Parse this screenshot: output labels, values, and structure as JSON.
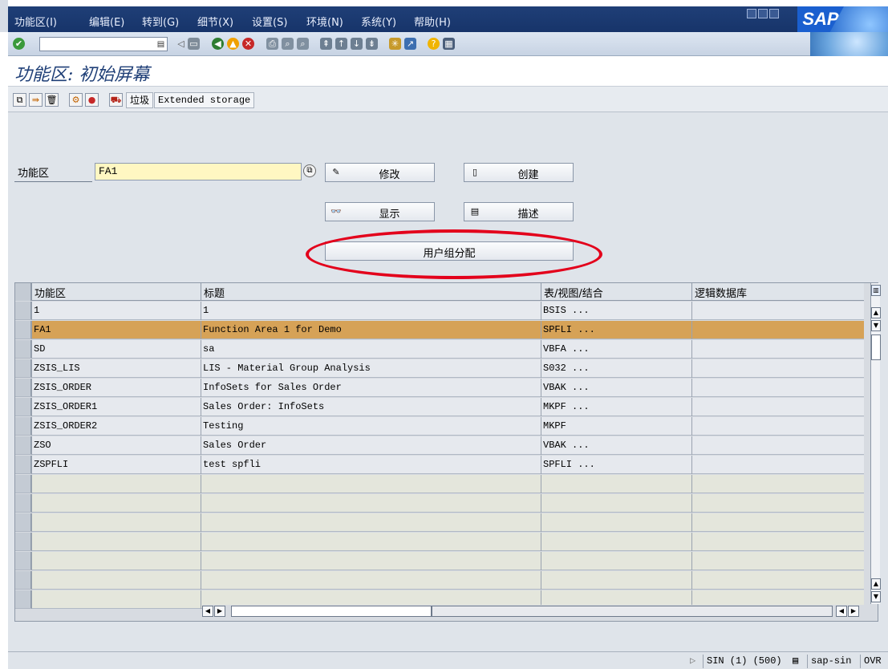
{
  "menu": [
    "功能区(I)",
    "编辑(E)",
    "转到(G)",
    "细节(X)",
    "设置(S)",
    "环境(N)",
    "系统(Y)",
    "帮助(H)"
  ],
  "logo": "SAP",
  "title": "功能区: 初始屏幕",
  "app_toolbar": {
    "trash_label": "垃圾",
    "extended_label": "Extended storage"
  },
  "form": {
    "label": "功能区",
    "value": "FA1"
  },
  "buttons": {
    "change": "修改",
    "create": "创建",
    "display": "显示",
    "describe": "描述",
    "user_group": "用户组分配"
  },
  "table": {
    "columns": [
      "功能区",
      "标题",
      "表/视图/结合",
      "逻辑数据库"
    ],
    "rows": [
      [
        "1",
        "1",
        "BSIS ...",
        ""
      ],
      [
        "FA1",
        "Function Area 1 for Demo",
        "SPFLI ...",
        ""
      ],
      [
        "SD",
        "sa",
        "VBFA ...",
        ""
      ],
      [
        "ZSIS_LIS",
        "LIS - Material Group Analysis",
        "S032 ...",
        ""
      ],
      [
        "ZSIS_ORDER",
        "InfoSets for Sales Order",
        "VBAK ...",
        ""
      ],
      [
        "ZSIS_ORDER1",
        "Sales Order: InfoSets",
        "MKPF ...",
        ""
      ],
      [
        "ZSIS_ORDER2",
        "Testing",
        "MKPF",
        ""
      ],
      [
        "ZSO",
        "Sales Order",
        "VBAK ...",
        ""
      ],
      [
        "ZSPFLI",
        "test spfli",
        "SPFLI ...",
        ""
      ]
    ],
    "selected_row": 1,
    "empty_rows": 7
  },
  "status": {
    "system": "SIN (1) (500)",
    "server": "sap-sin",
    "mode": "OVR"
  },
  "colors": {
    "menubar": "#1f3f77",
    "selected_row": "#d6a257",
    "highlight_ellipse": "#e3001b",
    "input_bg": "#fff7c2"
  }
}
